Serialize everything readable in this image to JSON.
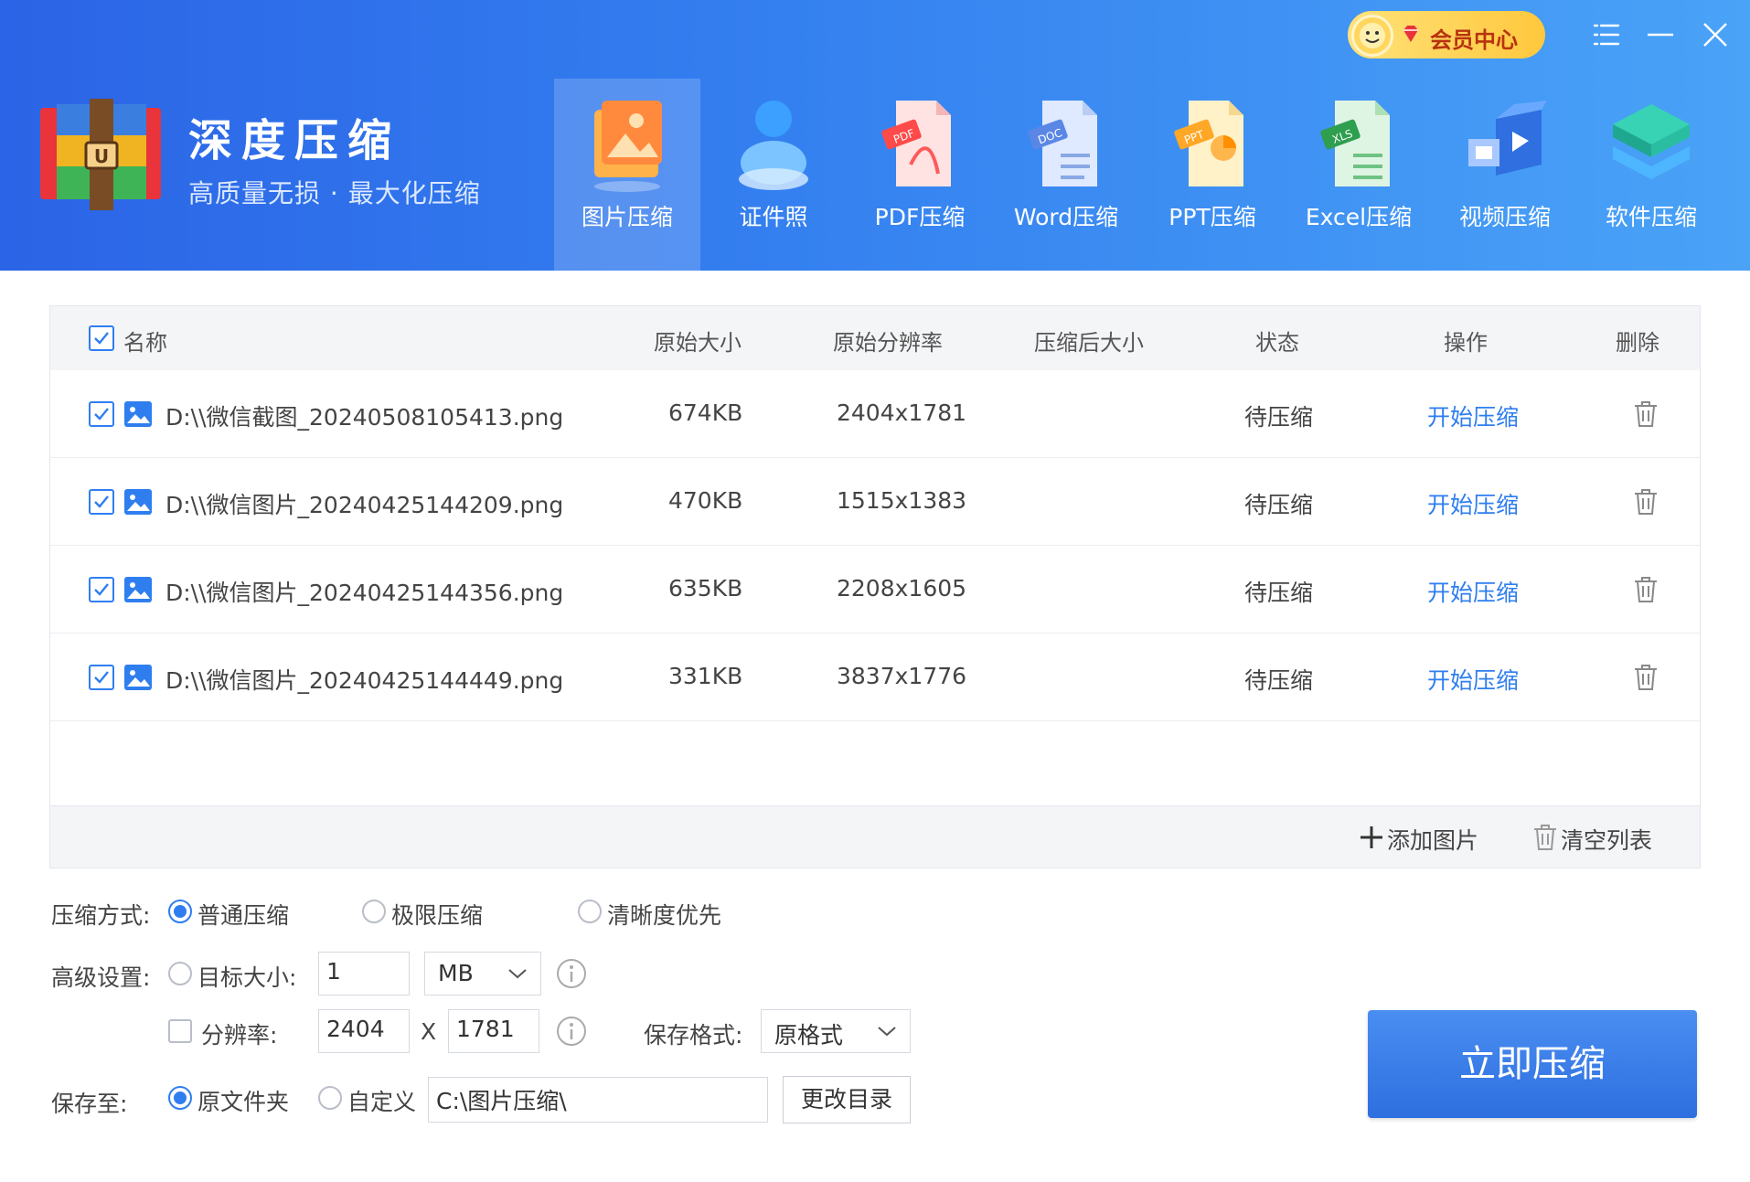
{
  "app": {
    "title": "深度压缩",
    "subtitle": "高质量无损 · 最大化压缩",
    "vip_label": "会员中心"
  },
  "tools": [
    {
      "label": "图片压缩",
      "icon": "image-compress-icon",
      "active": true
    },
    {
      "label": "证件照",
      "icon": "id-photo-icon",
      "active": false
    },
    {
      "label": "PDF压缩",
      "icon": "pdf-file-icon",
      "active": false
    },
    {
      "label": "Word压缩",
      "icon": "doc-file-icon",
      "active": false
    },
    {
      "label": "PPT压缩",
      "icon": "ppt-file-icon",
      "active": false
    },
    {
      "label": "Excel压缩",
      "icon": "xls-file-icon",
      "active": false
    },
    {
      "label": "视频压缩",
      "icon": "video-compress-icon",
      "active": false
    },
    {
      "label": "软件压缩",
      "icon": "software-compress-icon",
      "active": false
    }
  ],
  "table": {
    "headers": {
      "name": "名称",
      "orig_size": "原始大小",
      "orig_res": "原始分辨率",
      "compressed_size": "压缩后大小",
      "status": "状态",
      "action": "操作",
      "delete": "删除"
    },
    "rows": [
      {
        "name": "D:\\\\微信截图_20240508105413.png",
        "size": "674KB",
        "res": "2404x1781",
        "compressed": "",
        "status": "待压缩",
        "action": "开始压缩"
      },
      {
        "name": "D:\\\\微信图片_20240425144209.png",
        "size": "470KB",
        "res": "1515x1383",
        "compressed": "",
        "status": "待压缩",
        "action": "开始压缩"
      },
      {
        "name": "D:\\\\微信图片_20240425144356.png",
        "size": "635KB",
        "res": "2208x1605",
        "compressed": "",
        "status": "待压缩",
        "action": "开始压缩"
      },
      {
        "name": "D:\\\\微信图片_20240425144449.png",
        "size": "331KB",
        "res": "3837x1776",
        "compressed": "",
        "status": "待压缩",
        "action": "开始压缩"
      }
    ],
    "add_label": "添加图片",
    "clear_label": "清空列表"
  },
  "settings": {
    "mode_label": "压缩方式:",
    "modes": [
      "普通压缩",
      "极限压缩",
      "清晰度优先"
    ],
    "advanced_label": "高级设置:",
    "target_size_label": "目标大小:",
    "target_size_value": "1",
    "target_unit": "MB",
    "resolution_label": "分辨率:",
    "res_width": "2404",
    "res_sep": "X",
    "res_height": "1781",
    "format_label": "保存格式:",
    "format_value": "原格式",
    "save_to_label": "保存至:",
    "save_original": "原文件夹",
    "save_custom": "自定义",
    "save_path": "C:\\图片压缩\\",
    "change_dir": "更改目录",
    "compress_now": "立即压缩"
  }
}
